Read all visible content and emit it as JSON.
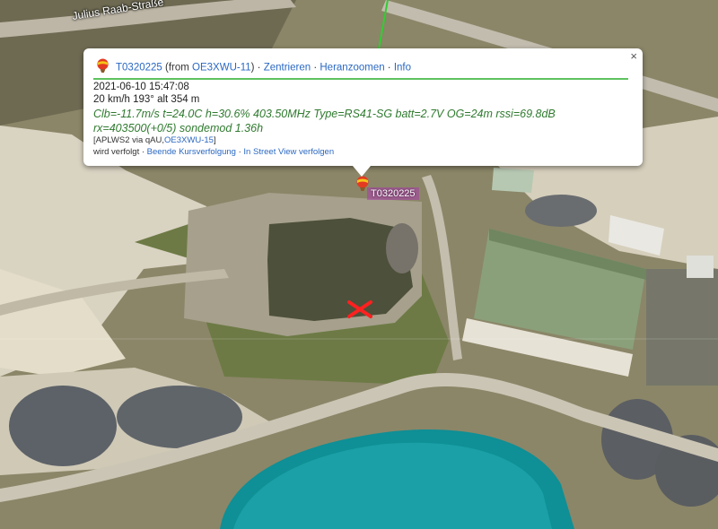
{
  "map": {
    "street_label": "Julius Raab-Straße",
    "colors": {
      "track_green": "#33cc33",
      "marker_label_bg": "#aa3caa",
      "x_red": "#ff2020",
      "water": "#0e8f95"
    }
  },
  "popup": {
    "callsign": "T0320225",
    "from_prefix": " (from ",
    "from_call": "OE3XWU-11",
    "from_suffix": ")",
    "sep": " · ",
    "links": {
      "center": "Zentrieren",
      "zoom": "Heranzoomen",
      "info": "Info"
    },
    "timestamp": "2021-06-10 15:47:08",
    "motion": "20 km/h 193° alt 354 m",
    "comment_line1": "Clb=-11.7m/s t=24.0C h=30.6% 403.50MHz Type=RS41-SG batt=2.7V OG=24m rssi=69.8dB",
    "comment_line2": "rx=403500(+0/5) sondemod 1.36h",
    "path_prefix": "[APLWS2 via qAU,",
    "path_call": "OE3XWU-15",
    "path_suffix": "]",
    "tracked_text": "wird verfolgt",
    "stop_tracking": "Beende Kursverfolgung",
    "street_view": "In Street View verfolgen",
    "close_icon": "×"
  },
  "marker": {
    "label": "T0320225",
    "icon": "balloon-icon"
  }
}
